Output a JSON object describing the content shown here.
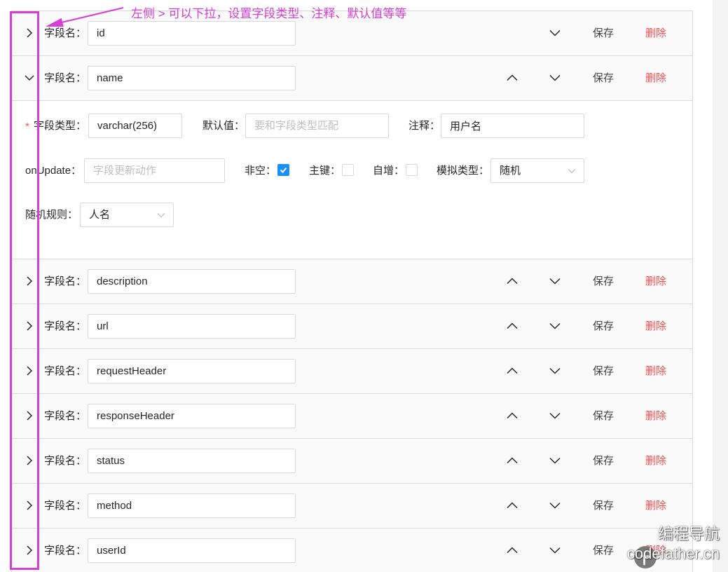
{
  "annotation": {
    "text": "左侧 > 可以下拉，设置字段类型、注释、默认值等等"
  },
  "field_label": "字段名：",
  "actions": {
    "expand_icon": "chevron-right-icon",
    "up_icon": "chevron-up-icon",
    "down_icon": "chevron-down-icon",
    "save": "保存",
    "delete": "删除"
  },
  "fields": [
    {
      "name": "id",
      "expanded": false
    },
    {
      "name": "name",
      "expanded": true
    },
    {
      "name": "description",
      "expanded": false
    },
    {
      "name": "url",
      "expanded": false
    },
    {
      "name": "requestHeader",
      "expanded": false
    },
    {
      "name": "responseHeader",
      "expanded": false
    },
    {
      "name": "status",
      "expanded": false
    },
    {
      "name": "method",
      "expanded": false
    },
    {
      "name": "userId",
      "expanded": false
    }
  ],
  "detail": {
    "required_mark": "*",
    "field_type": {
      "label": "字段类型：",
      "value": "varchar(256)"
    },
    "default_value": {
      "label": "默认值：",
      "placeholder": "要和字段类型匹配"
    },
    "comment": {
      "label": "注释：",
      "value": "用户名"
    },
    "on_update": {
      "label": "onUpdate：",
      "placeholder": "字段更新动作"
    },
    "not_null": {
      "label": "非空：",
      "checked": true
    },
    "primary_key": {
      "label": "主键：",
      "checked": false
    },
    "auto_increment": {
      "label": "自增：",
      "checked": false
    },
    "mock_type": {
      "label": "模拟类型：",
      "value": "随机"
    },
    "mock_rule": {
      "label": "随机规则：",
      "value": "人名"
    }
  },
  "watermark": {
    "title": "编程导航",
    "site": "codefather.cn",
    "logo_icon": "watermark-logo-icon"
  },
  "colors": {
    "danger": "#ff4d4f",
    "primary": "#1890ff",
    "annotation": "#d43fd4",
    "header_bg": "#fafafa",
    "border": "#d9d9d9",
    "text": "#262626",
    "placeholder": "#bfbfbf"
  }
}
